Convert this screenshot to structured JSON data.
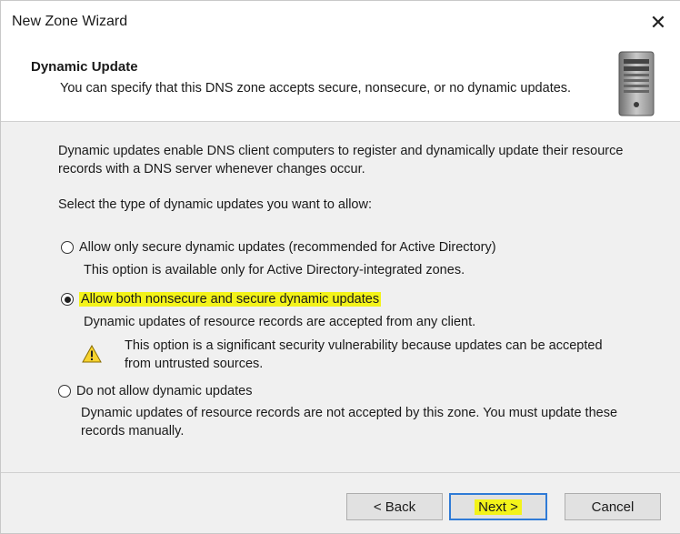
{
  "window": {
    "title": "New Zone Wizard"
  },
  "header": {
    "title": "Dynamic Update",
    "description": "You can specify that this DNS zone accepts secure, nonsecure, or no dynamic updates."
  },
  "body": {
    "intro": "Dynamic updates enable DNS client computers to register and dynamically update their resource records with a DNS server whenever changes occur.",
    "prompt": "Select the type of dynamic updates you want to allow:",
    "options": [
      {
        "label": "Allow only secure dynamic updates (recommended for Active Directory)",
        "description": "This option is available only for Active Directory-integrated zones.",
        "selected": false
      },
      {
        "label": "Allow both nonsecure and secure dynamic updates",
        "description": "Dynamic updates of resource records are accepted from any client.",
        "warning": "This option is a significant security vulnerability because updates can be accepted from untrusted sources.",
        "selected": true
      },
      {
        "label": "Do not allow dynamic updates",
        "description": "Dynamic updates of resource records are not accepted by this zone. You must update these records manually.",
        "selected": false
      }
    ]
  },
  "buttons": {
    "back": "< Back",
    "next": "Next >",
    "cancel": "Cancel"
  },
  "colors": {
    "highlight": "#f3f31a",
    "focus_border": "#2f7bd6",
    "dialog_bg": "#f0f0f0"
  }
}
